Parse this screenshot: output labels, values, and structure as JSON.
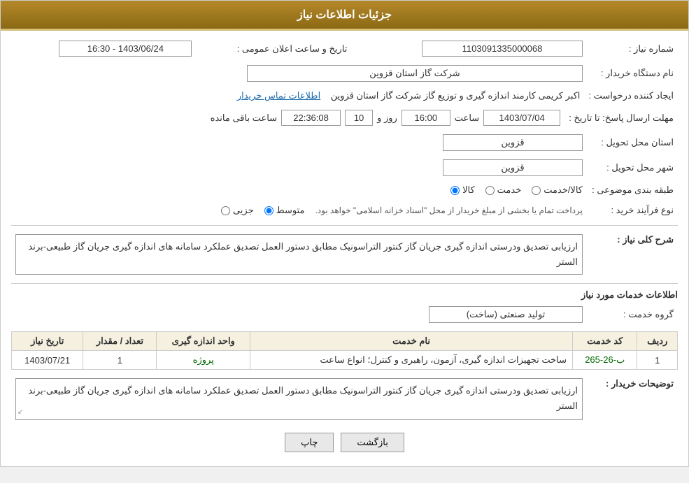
{
  "header": {
    "title": "جزئیات اطلاعات نیاز"
  },
  "fields": {
    "shomara_niaz_label": "شماره نیاز :",
    "shomara_niaz_value": "1103091335000068",
    "nam_dastgah_label": "نام دستگاه خریدار :",
    "nam_dastgah_value": "شرکت گاز استان قزوین",
    "ijad_konande_label": "ایجاد کننده درخواست :",
    "ijad_konande_value": "اکبر کریمی کارمند اندازه گیری و توزیع گاز شرکت گاز استان قزوین",
    "contact_link": "اطلاعات تماس خریدار",
    "mohlat_label": "مهلت ارسال پاسخ: تا تاریخ :",
    "mohlat_date": "1403/07/04",
    "mohlat_time": "16:00",
    "mohlat_days": "10",
    "mohlat_remaining": "22:36:08",
    "mohlat_days_label": "روز و",
    "mohlat_remaining_label": "ساعت باقی مانده",
    "ostan_tahvil_label": "استان محل تحویل :",
    "ostan_tahvil_value": "قزوین",
    "shahr_tahvil_label": "شهر محل تحویل :",
    "shahr_tahvil_value": "قزوین",
    "tabaqe_label": "طبقه بندی موضوعی :",
    "radio_kala": "کالا",
    "radio_khedmat": "خدمت",
    "radio_kala_khedmat": "کالا/خدمت",
    "radio_kala_selected": true,
    "noע_farayand_label": "نوع فرآیند خرید :",
    "radio_jozii": "جزیی",
    "radio_motavasset": "متوسط",
    "radio_jozii_selected": false,
    "radio_motavasset_selected": true,
    "note_payment": "پرداخت تمام یا بخشی از مبلغ خریدار از محل \"اسناد خزانه اسلامی\" خواهد بود.",
    "tarikh_aalan_label": "تاریخ و ساعت اعلان عمومی :",
    "tarikh_aalan_value": "1403/06/24 - 16:30"
  },
  "sharh": {
    "title": "شرح کلی نیاز :",
    "text": "ارزیابی تصدیق ودرستی اندازه گیری جریان گاز کنتور التراسونیک مطابق دستور العمل تصدیق عملکرد سامانه های اندازه گیری جریان گاز طبیعی-برند الستر"
  },
  "services_info": {
    "title": "اطلاعات خدمات مورد نیاز",
    "grooh_label": "گروه خدمت :",
    "grooh_value": "تولید صنعتی (ساخت)",
    "table_headers": [
      "ردیف",
      "کد خدمت",
      "نام خدمت",
      "واحد اندازه گیری",
      "تعداد / مقدار",
      "تاریخ نیاز"
    ],
    "table_rows": [
      {
        "radif": "1",
        "kod_khedmat": "ب-26-265",
        "nam_khedmat": "ساخت تجهیزات اندازه گیری، آزمون، راهبری و کنترل؛ انواع ساعت",
        "vahed": "پروژه",
        "tedad": "1",
        "tarikh": "1403/07/21"
      }
    ]
  },
  "tawzih": {
    "title": "توضیحات خریدار :",
    "text": "ارزیابی تصدیق ودرستی اندازه گیری جریان گاز کنتور التراسونیک مطابق دستور العمل تصدیق عملکرد سامانه های اندازه گیری جریان گاز طبیعی-برند الستر"
  },
  "buttons": {
    "print_label": "چاپ",
    "back_label": "بازگشت"
  }
}
